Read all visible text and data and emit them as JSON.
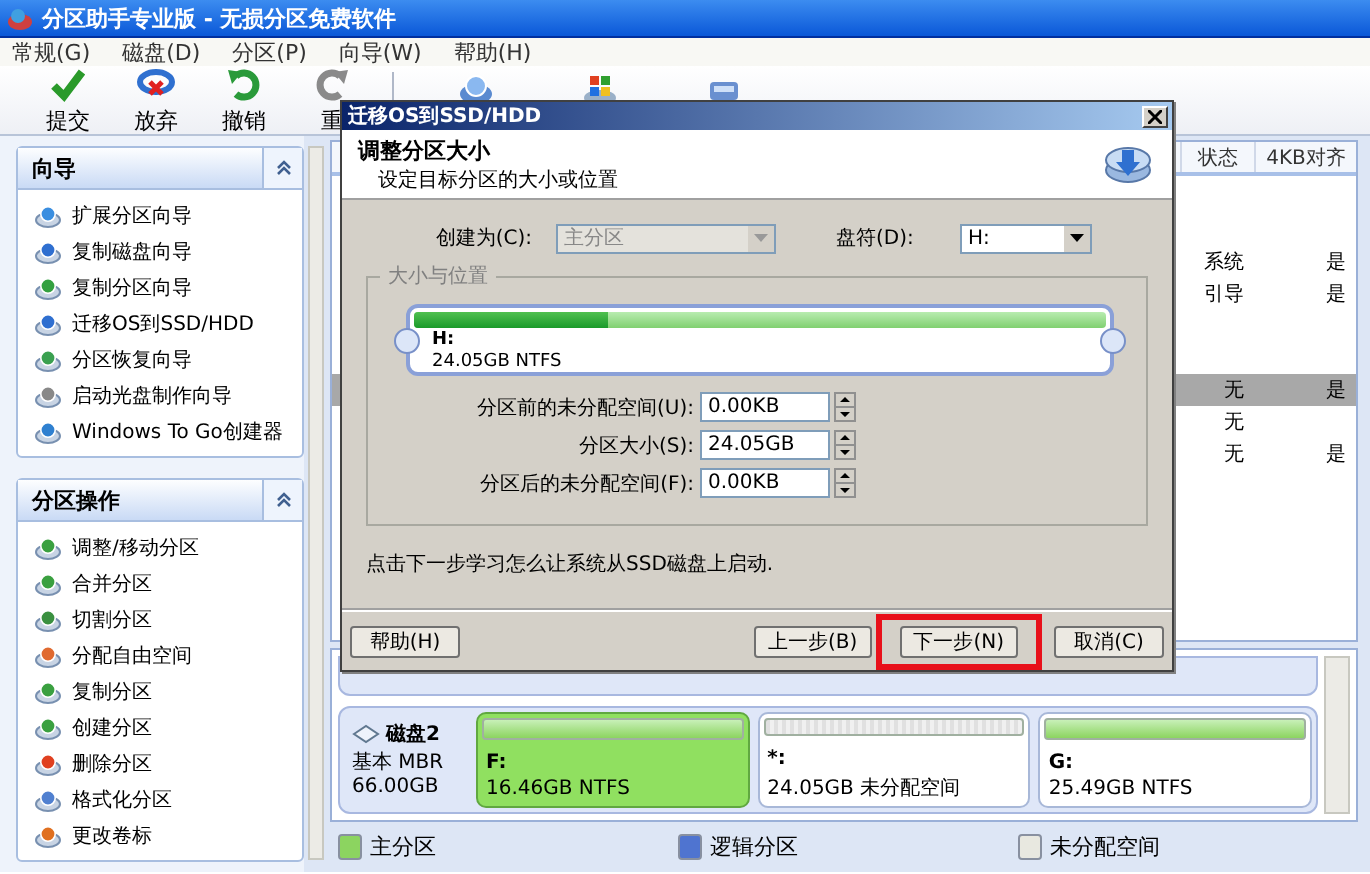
{
  "window": {
    "title": "分区助手专业版 - 无损分区免费软件"
  },
  "menu": [
    "常规(G)",
    "磁盘(D)",
    "分区(P)",
    "向导(W)",
    "帮助(H)"
  ],
  "toolbar": [
    {
      "kind": "apply",
      "label": "提交"
    },
    {
      "kind": "discard",
      "label": "放弃"
    },
    {
      "kind": "undo",
      "label": "撤销"
    },
    {
      "kind": "redo",
      "label": "重"
    },
    {
      "kind": "separator"
    },
    {
      "kind": "disk"
    },
    {
      "kind": "windows"
    },
    {
      "kind": "drive"
    }
  ],
  "sidebar": [
    {
      "title": "向导",
      "items": [
        "扩展分区向导",
        "复制磁盘向导",
        "复制分区向导",
        "迁移OS到SSD/HDD",
        "分区恢复向导",
        "启动光盘制作向导",
        "Windows To Go创建器"
      ]
    },
    {
      "title": "分区操作",
      "items": [
        "调整/移动分区",
        "合并分区",
        "切割分区",
        "分配自由空间",
        "复制分区",
        "创建分区",
        "删除分区",
        "格式化分区",
        "更改卷标"
      ]
    }
  ],
  "table": {
    "columns": [
      "状态",
      "4KB对齐"
    ],
    "rows": [
      {
        "selected": false
      },
      {
        "selected": false
      },
      {
        "status": "系统",
        "aligned": "是",
        "selected": false
      },
      {
        "status": "引导",
        "aligned": "是",
        "selected": false
      },
      {
        "selected": false
      },
      {
        "selected": false
      },
      {
        "status": "无",
        "aligned": "是",
        "selected": true
      },
      {
        "status": "无",
        "selected": false
      },
      {
        "status": "无",
        "aligned": "是",
        "selected": false
      }
    ]
  },
  "disks": [
    {
      "name": "磁盘2",
      "type": "基本 MBR",
      "size": "66.00GB",
      "partitions": [
        {
          "letter": "F:",
          "info": "16.46GB NTFS",
          "kind": "primary",
          "selected": true
        },
        {
          "letter": "*:",
          "info": "24.05GB 未分配空间",
          "kind": "unallocated",
          "selected": false
        },
        {
          "letter": "G:",
          "info": "25.49GB NTFS",
          "kind": "primary",
          "selected": false
        }
      ]
    }
  ],
  "legend": [
    {
      "kind": "primary",
      "label": "主分区"
    },
    {
      "kind": "logical",
      "label": "逻辑分区"
    },
    {
      "kind": "unallocated",
      "label": "未分配空间"
    }
  ],
  "dialog": {
    "title": "迁移OS到SSD/HDD",
    "heading": "调整分区大小",
    "subheading": "设定目标分区的大小或位置",
    "create_as": {
      "label": "创建为(C):",
      "value": "主分区",
      "disabled": true
    },
    "drive_letter": {
      "label": "盘符(D):",
      "value": "H:",
      "disabled": false
    },
    "group_title": "大小与位置",
    "partition": {
      "letter": "H:",
      "info": "24.05GB NTFS",
      "level": 0.28
    },
    "fields": [
      {
        "label": "分区前的未分配空间(U):",
        "value": "0.00KB"
      },
      {
        "label": "分区大小(S):",
        "value": "24.05GB"
      },
      {
        "label": "分区后的未分配空间(F):",
        "value": "0.00KB"
      }
    ],
    "note": "点击下一步学习怎么让系统从SSD磁盘上启动.",
    "buttons": [
      {
        "label": "帮助(H)",
        "highlighted": false
      },
      {
        "label": "上一步(B)",
        "highlighted": false
      },
      {
        "label": "下一步(N)",
        "highlighted": true
      },
      {
        "label": "取消(C)",
        "highlighted": false
      }
    ]
  }
}
